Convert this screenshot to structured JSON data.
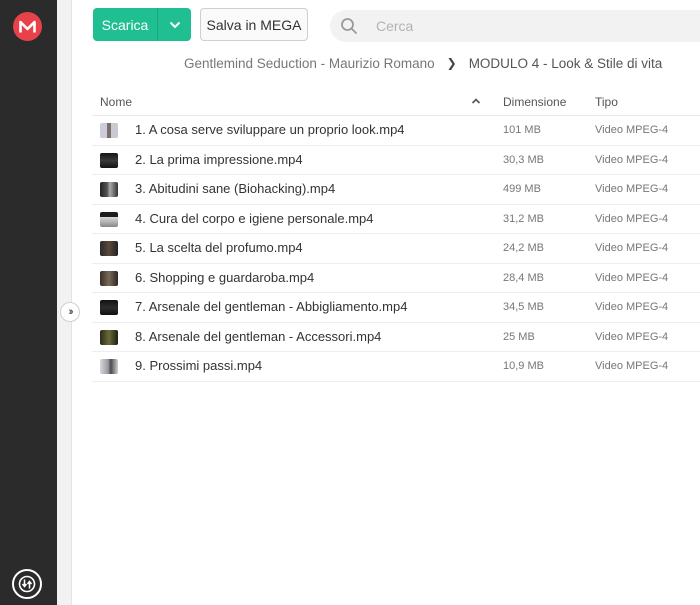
{
  "toolbar": {
    "download_label": "Scarica",
    "save_label": "Salva in MEGA"
  },
  "search": {
    "placeholder": "Cerca"
  },
  "breadcrumb": {
    "parent": "Gentlemind Seduction - Maurizio Romano",
    "current": "MODULO 4 - Look & Stile di vita"
  },
  "table": {
    "headers": {
      "name": "Nome",
      "size": "Dimensione",
      "type": "Tipo"
    },
    "rows": [
      {
        "name": "1. A cosa serve sviluppare un proprio look.mp4",
        "size": "101 MB",
        "type": "Video MPEG-4"
      },
      {
        "name": "2. La prima impressione.mp4",
        "size": "30,3 MB",
        "type": "Video MPEG-4"
      },
      {
        "name": "3. Abitudini sane (Biohacking).mp4",
        "size": "499 MB",
        "type": "Video MPEG-4"
      },
      {
        "name": "4. Cura del corpo e igiene personale.mp4",
        "size": "31,2 MB",
        "type": "Video MPEG-4"
      },
      {
        "name": "5. La scelta del profumo.mp4",
        "size": "24,2 MB",
        "type": "Video MPEG-4"
      },
      {
        "name": "6. Shopping e guardaroba.mp4",
        "size": "28,4 MB",
        "type": "Video MPEG-4"
      },
      {
        "name": "7. Arsenale del gentleman - Abbigliamento.mp4",
        "size": "34,5 MB",
        "type": "Video MPEG-4"
      },
      {
        "name": "8. Arsenale del gentleman - Accessori.mp4",
        "size": "25 MB",
        "type": "Video MPEG-4"
      },
      {
        "name": "9. Prossimi passi.mp4",
        "size": "10,9 MB",
        "type": "Video MPEG-4"
      }
    ]
  },
  "colors": {
    "accent": "#1fbf91",
    "brand": "#e8414a",
    "rail": "#2b2b2b"
  }
}
